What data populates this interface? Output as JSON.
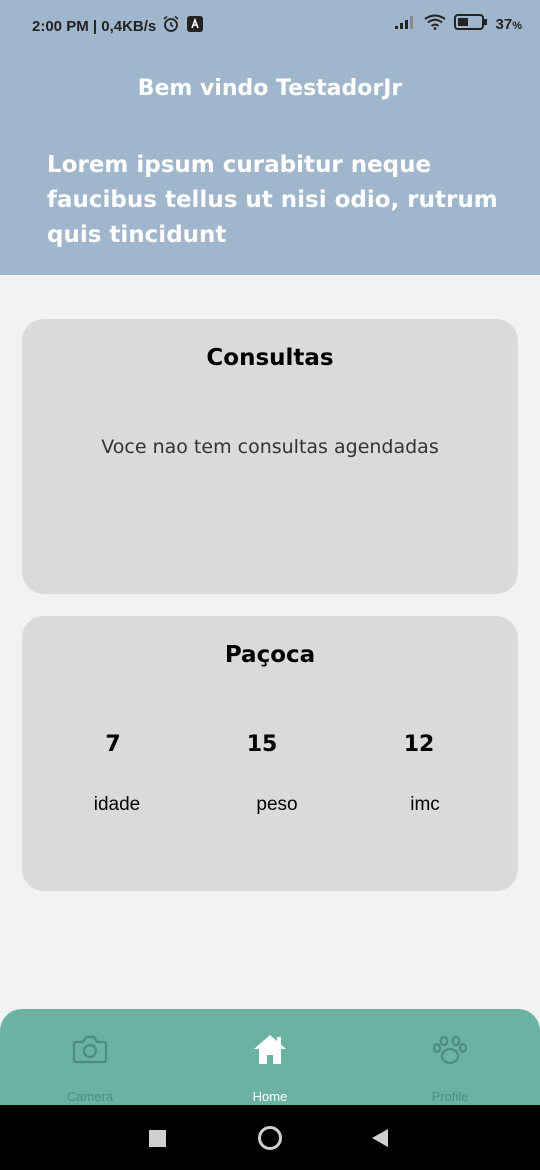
{
  "status_bar": {
    "time_speed": "2:00 PM | 0,4KB/s",
    "battery": "37",
    "battery_unit": "%"
  },
  "header": {
    "welcome": "Bem vindo TestadorJr",
    "subtitle": "Lorem ipsum curabitur neque faucibus tellus ut nisi odio, rutrum quis tincidunt"
  },
  "consultas_card": {
    "title": "Consultas",
    "message": "Voce nao tem consultas agendadas"
  },
  "pet_card": {
    "title": "Paçoca",
    "stats": [
      {
        "value": "7",
        "label": "idade"
      },
      {
        "value": "15",
        "label": "peso"
      },
      {
        "value": "12",
        "label": "imc"
      }
    ]
  },
  "bottom_nav": {
    "items": [
      {
        "label": "Camera",
        "icon": "camera-icon",
        "active": false
      },
      {
        "label": "Home",
        "icon": "home-icon",
        "active": true
      },
      {
        "label": "Profile",
        "icon": "paw-icon",
        "active": false
      }
    ]
  },
  "colors": {
    "header_bg": "#a0b6cc",
    "card_bg": "#dadada",
    "nav_bg": "#6bb2a3",
    "nav_active": "#ffffff",
    "nav_inactive": "#4e8c80"
  }
}
